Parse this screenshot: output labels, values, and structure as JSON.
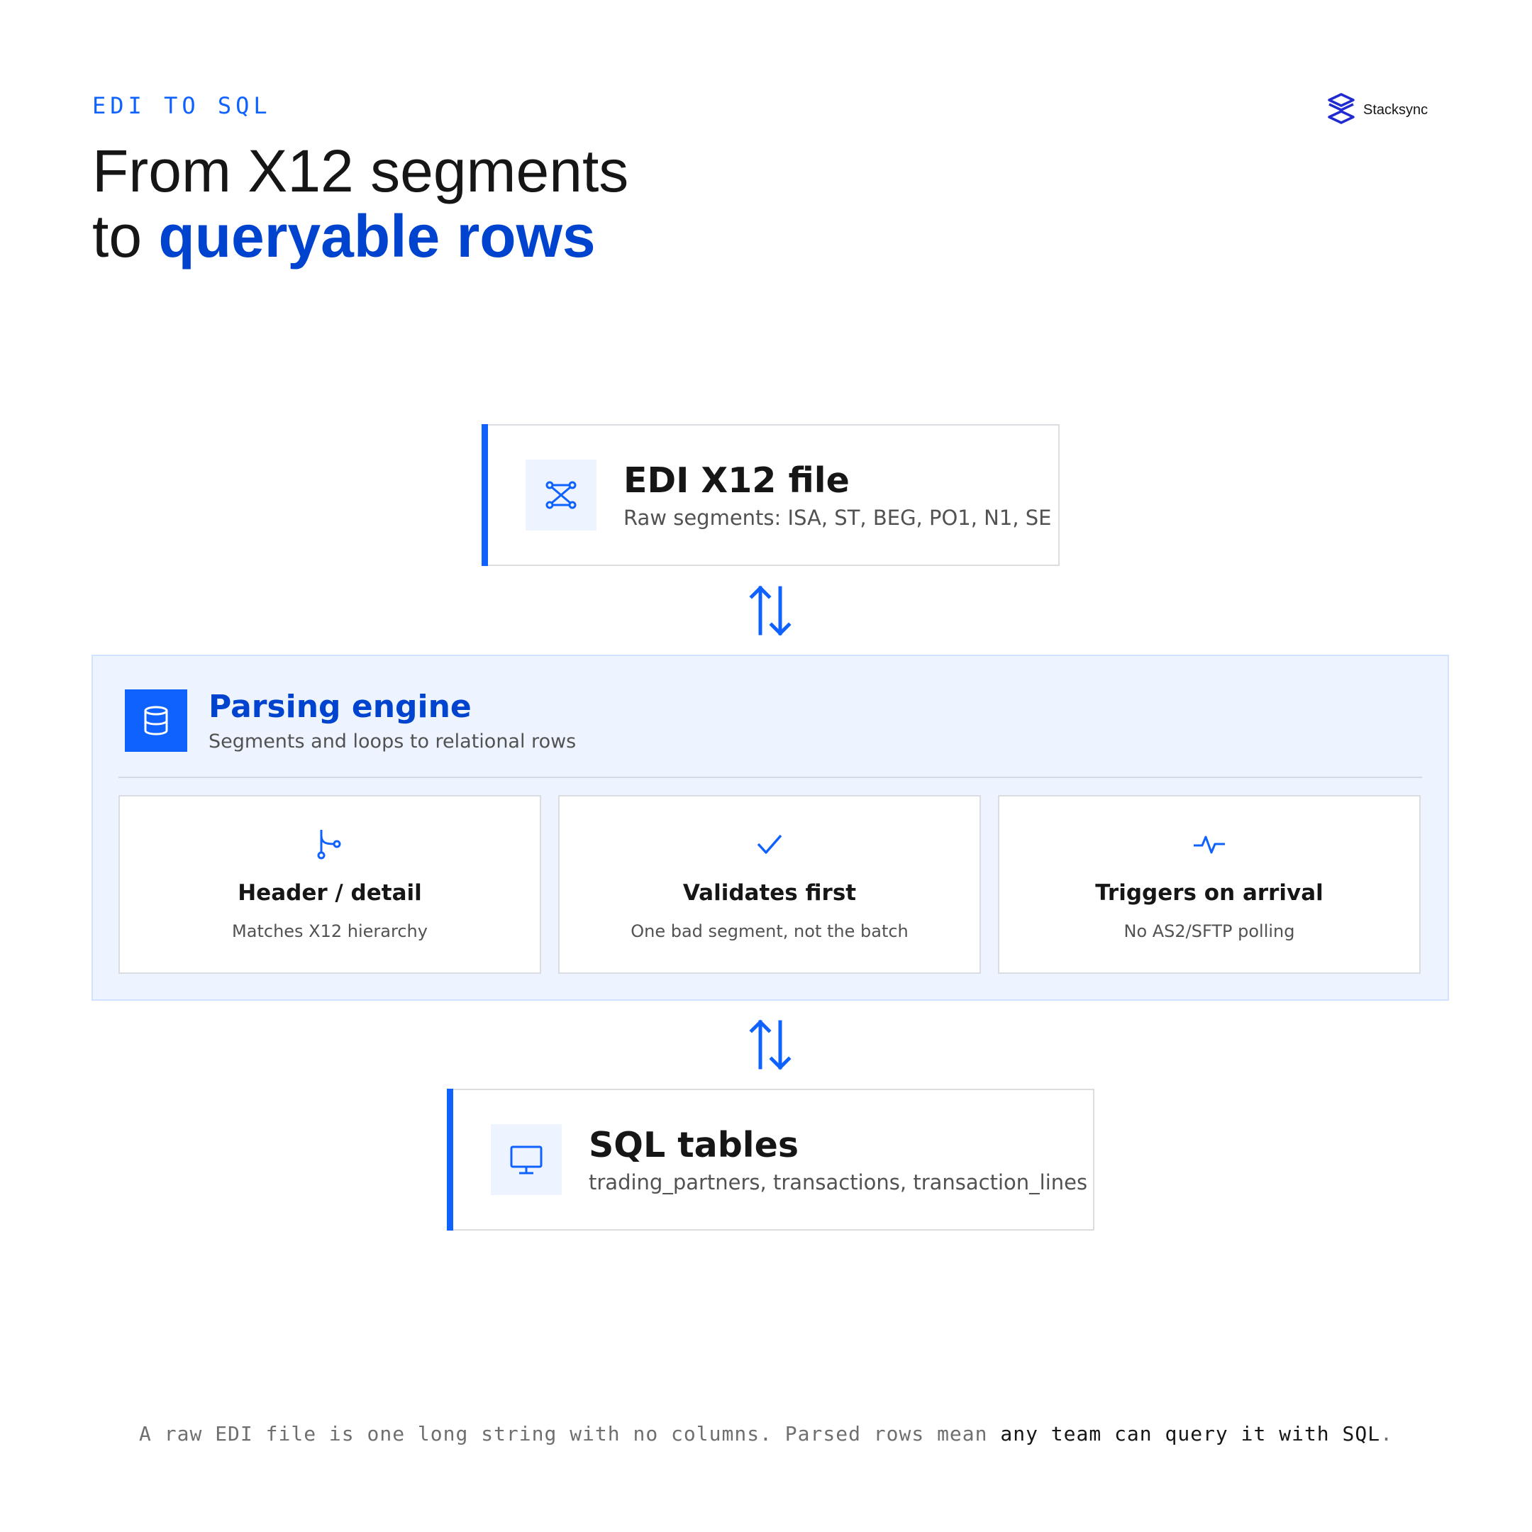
{
  "header": {
    "eyebrow": "EDI TO SQL",
    "title_line1": "From X12 segments",
    "title_line2_prefix": "to ",
    "title_line2_highlight": "queryable rows"
  },
  "brand": {
    "name": "Stacksync",
    "icon": "stacksync-logo-icon"
  },
  "colors": {
    "accent": "#0f62fe",
    "accent_dark": "#0043ce",
    "panel_bg": "#edf4ff",
    "text": "#161616",
    "muted": "#525252"
  },
  "source_card": {
    "title": "EDI X12 file",
    "subtitle": "Raw segments: ISA, ST, BEG, PO1, N1, SE",
    "icon": "connection-network-icon"
  },
  "parsing_engine": {
    "title": "Parsing engine",
    "subtitle": "Segments and loops to relational rows",
    "icon": "database-icon",
    "features": [
      {
        "title": "Header / detail",
        "subtitle": "Matches X12 hierarchy",
        "icon": "branch-icon"
      },
      {
        "title": "Validates first",
        "subtitle": "One bad segment, not the batch",
        "icon": "checkmark-icon"
      },
      {
        "title": "Triggers on arrival",
        "subtitle": "No AS2/SFTP polling",
        "icon": "activity-pulse-icon"
      }
    ]
  },
  "target_card": {
    "title": "SQL tables",
    "subtitle": "trading_partners, transactions, transaction_lines",
    "icon": "monitor-icon"
  },
  "footer": {
    "text_plain": "A raw EDI file is one long string with no columns. Parsed rows mean ",
    "text_emphasis": "any team can query it with SQL",
    "text_end": "."
  }
}
